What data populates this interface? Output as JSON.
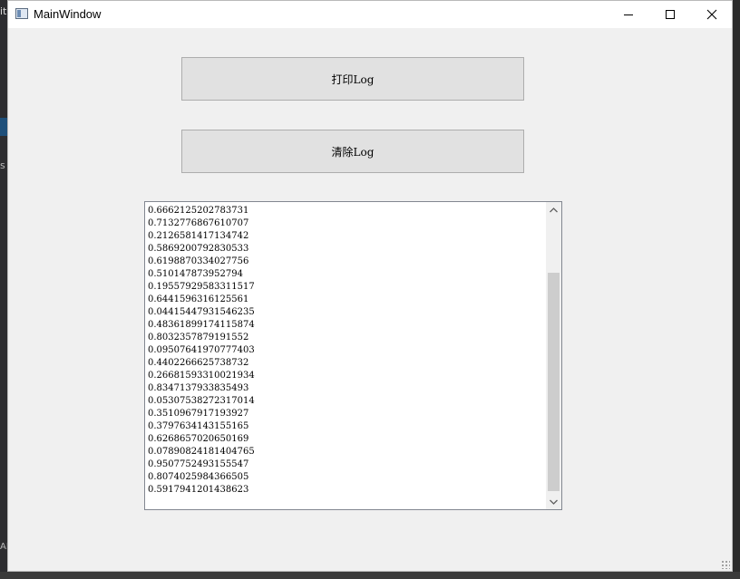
{
  "background": {
    "left_text_top": "it",
    "left_text_mid": "s",
    "left_text_bottom": "AI"
  },
  "window": {
    "title": "MainWindow",
    "icon": "window-app-icon"
  },
  "buttons": {
    "print_label": "打印Log",
    "clear_label": "清除Log"
  },
  "log": {
    "lines": [
      "0.6662125202783731",
      "0.7132776867610707",
      "0.2126581417134742",
      "0.5869200792830533",
      "0.6198870334027756",
      "0.510147873952794",
      "0.19557929583311517",
      "0.6441596316125561",
      "0.04415447931546235",
      "0.48361899174115874",
      "0.8032357879191552",
      "0.09507641970777403",
      "0.4402266625738732",
      "0.26681593310021934",
      "0.8347137933835493",
      "0.05307538272317014",
      "0.3510967917193927",
      "0.3797634143155165",
      "0.6268657020650169",
      "0.07890824181404765",
      "0.9507752493155547",
      "0.8074025984366505",
      "0.5917941201438623"
    ],
    "scroll_position": 0.24
  }
}
